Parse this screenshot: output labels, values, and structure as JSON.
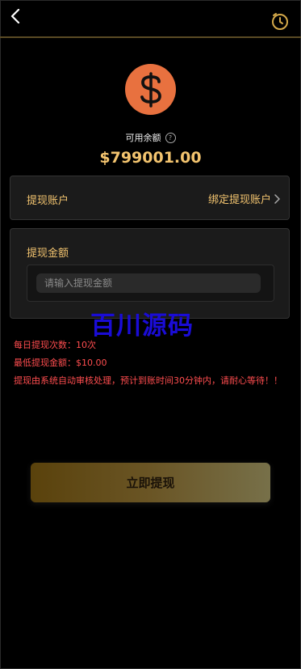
{
  "header": {
    "back_icon": "chevron-left-icon",
    "history_icon": "history-clock-icon"
  },
  "balance": {
    "icon": "dollar-coin-icon",
    "label": "可用余额",
    "help_glyph": "?",
    "amount": "$799001.00"
  },
  "account": {
    "label": "提现账户",
    "bind_label": "绑定提现账户"
  },
  "amount": {
    "label": "提现金额",
    "placeholder": "请输入提现金额"
  },
  "watermark": "百川源码",
  "notes": [
    "每日提现次数：10次",
    "最低提现金额：$10.00",
    "提现由系统自动审核处理，预计到账时间30分钟内，请耐心等待！！"
  ],
  "submit_label": "立即提现",
  "colors": {
    "accent_gold": "#f3c46f",
    "coin_orange": "#e8713f",
    "note_red": "#ff4d4f",
    "watermark_blue": "#1a0cd6"
  }
}
